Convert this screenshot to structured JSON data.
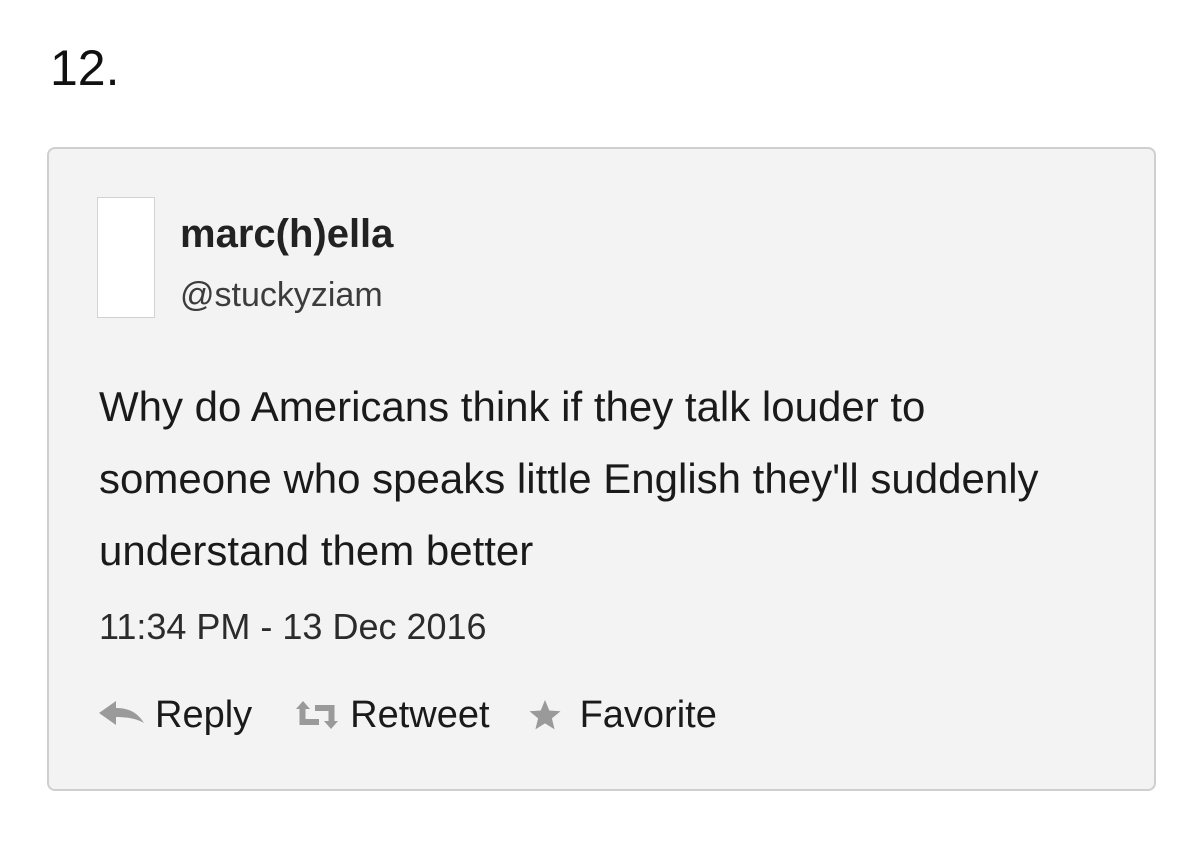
{
  "item_number": "12.",
  "tweet": {
    "display_name": "marc(h)ella",
    "handle": "@stuckyziam",
    "text": "Why do Americans think if they talk louder to someone who speaks little English they'll suddenly understand them better",
    "timestamp": "11:34 PM - 13 Dec 2016",
    "actions": {
      "reply_label": "Reply",
      "reply_icon": "reply-icon",
      "retweet_label": "Retweet",
      "retweet_icon": "retweet-icon",
      "favorite_label": "Favorite",
      "favorite_icon": "star-icon"
    }
  },
  "colors": {
    "card_background": "#f3f3f3",
    "card_border": "#cfcfcf",
    "icon_gray": "#9a9a9a"
  }
}
